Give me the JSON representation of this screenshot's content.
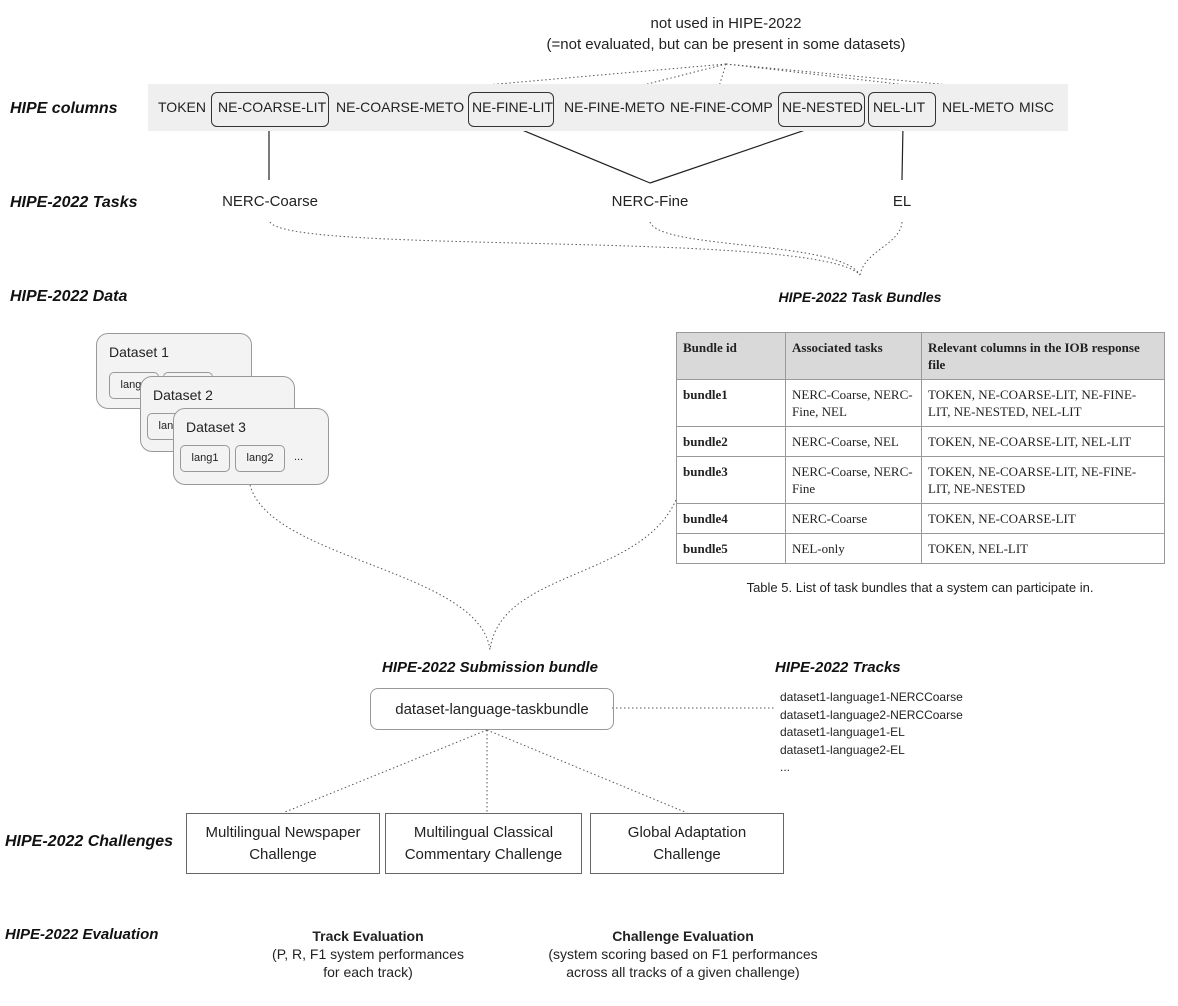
{
  "note": {
    "line1": "not used in HIPE-2022",
    "line2": "(=not evaluated, but can be present in some datasets)"
  },
  "labels": {
    "columns": "HIPE columns",
    "tasks": "HIPE-2022 Tasks",
    "data": "HIPE-2022 Data",
    "bundles": "HIPE-2022 Task Bundles",
    "submission": "HIPE-2022 Submission bundle",
    "tracks": "HIPE-2022 Tracks",
    "challenges": "HIPE-2022 Challenges",
    "evaluation": "HIPE-2022 Evaluation"
  },
  "columns": [
    "TOKEN",
    "NE-COARSE-LIT",
    "NE-COARSE-METO",
    "NE-FINE-LIT",
    "NE-FINE-METO",
    "NE-FINE-COMP",
    "NE-NESTED",
    "NEL-LIT",
    "NEL-METO",
    "MISC"
  ],
  "tasks": [
    "NERC-Coarse",
    "NERC-Fine",
    "EL"
  ],
  "datasets": [
    "Dataset 1",
    "Dataset 2",
    "Dataset 3"
  ],
  "langs": [
    "lang1",
    "lang2",
    "..."
  ],
  "table": {
    "headers": [
      "Bundle id",
      "Associated tasks",
      "Relevant columns in the IOB response file"
    ],
    "rows": [
      [
        "bundle1",
        "NERC-Coarse, NERC-Fine, NEL",
        "TOKEN, NE-COARSE-LIT, NE-FINE-LIT, NE-NESTED, NEL-LIT"
      ],
      [
        "bundle2",
        "NERC-Coarse, NEL",
        "TOKEN, NE-COARSE-LIT, NEL-LIT"
      ],
      [
        "bundle3",
        "NERC-Coarse, NERC-Fine",
        "TOKEN, NE-COARSE-LIT, NE-FINE-LIT, NE-NESTED"
      ],
      [
        "bundle4",
        "NERC-Coarse",
        "TOKEN, NE-COARSE-LIT"
      ],
      [
        "bundle5",
        "NEL-only",
        "TOKEN, NEL-LIT"
      ]
    ],
    "caption": "Table 5. List of task bundles that a system can participate in."
  },
  "submission_box": "dataset-language-taskbundle",
  "tracks": [
    "dataset1-language1-NERCCoarse",
    "dataset1-language2-NERCCoarse",
    "dataset1-language1-EL",
    "dataset1-language2-EL",
    "..."
  ],
  "challenges": [
    {
      "l1": "Multilingual Newspaper",
      "l2": "Challenge"
    },
    {
      "l1": "Multilingual Classical",
      "l2": "Commentary Challenge"
    },
    {
      "l1": "Global Adaptation",
      "l2": "Challenge"
    }
  ],
  "evaluation": {
    "track": {
      "title": "Track Evaluation",
      "l1": "(P, R, F1 system performances",
      "l2": "for each track)"
    },
    "challenge": {
      "title": "Challenge Evaluation",
      "l1": "(system scoring based on F1 performances",
      "l2": "across all tracks of a given challenge)"
    }
  }
}
